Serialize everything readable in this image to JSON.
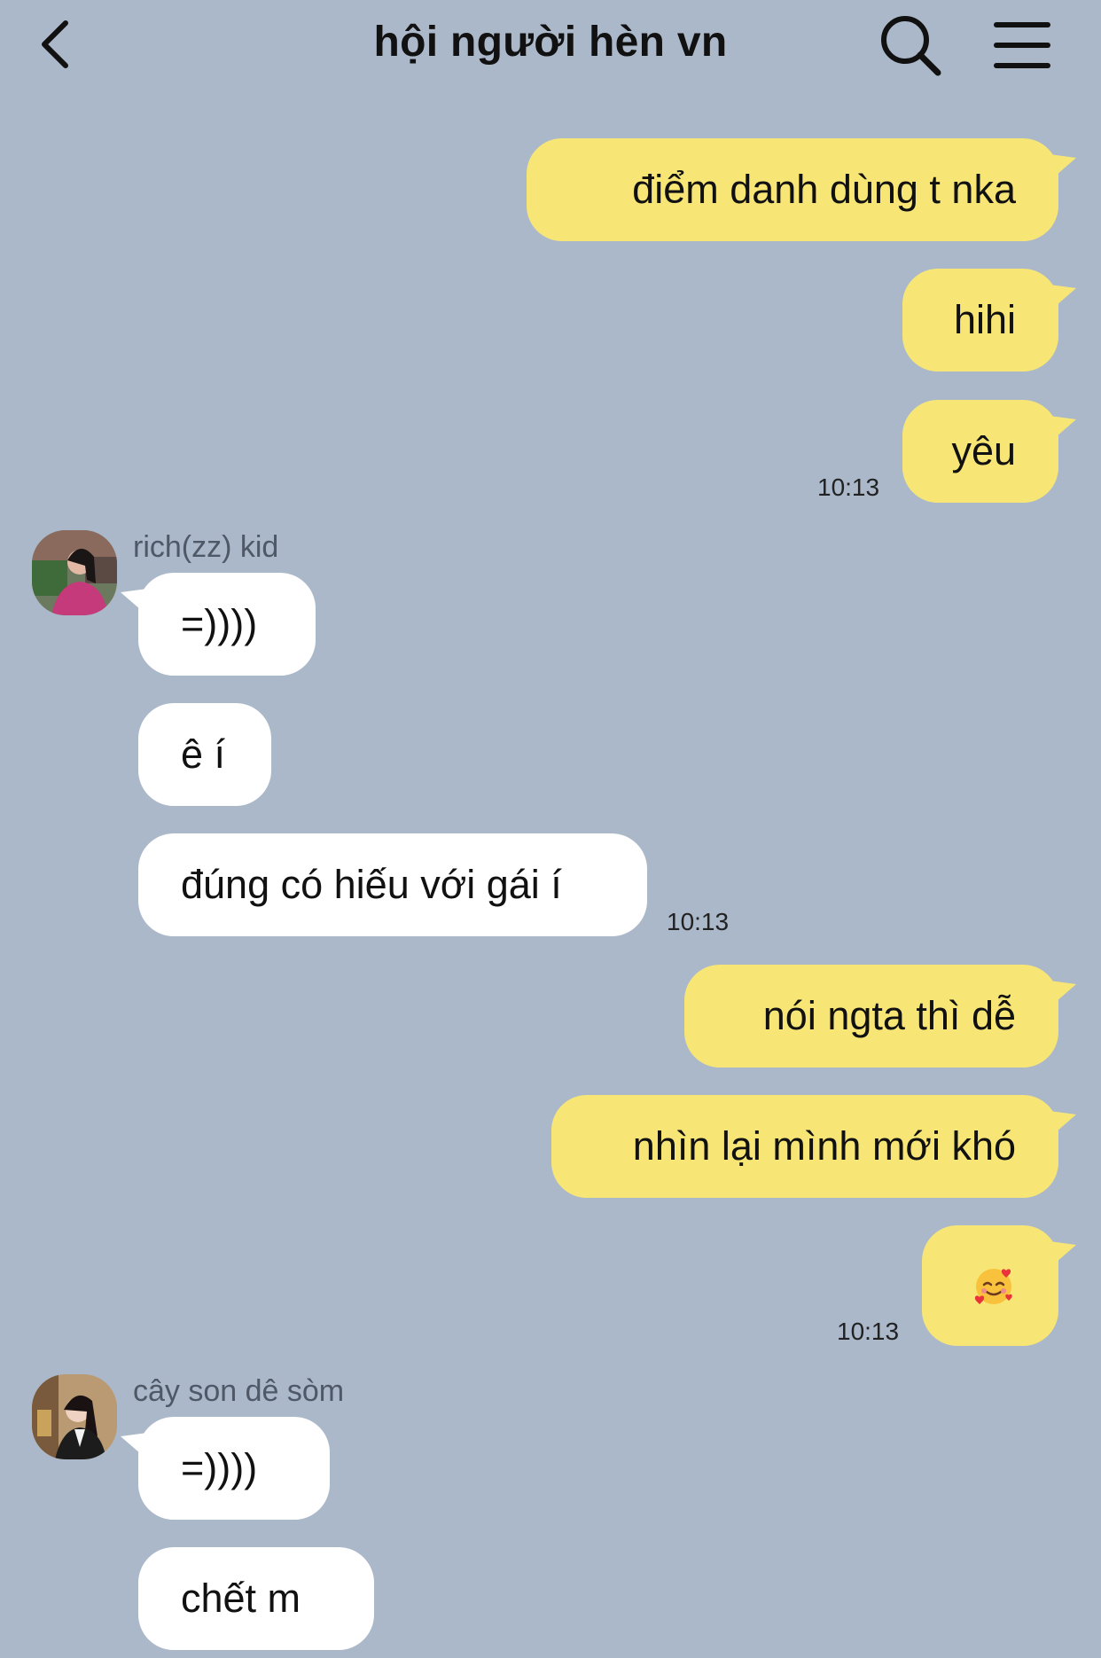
{
  "header": {
    "title": "hội người hèn vn"
  },
  "messages": {
    "out1": "điểm danh dùng t nka",
    "out2": "hihi",
    "out3": "yêu",
    "time1": "10:13",
    "sender1": "rich(zz) kid",
    "in1": "=))))",
    "in2": "ê í",
    "in3": "đúng có hiếu với gái í",
    "time2": "10:13",
    "out4": "nói ngta thì dễ",
    "out5": "nhìn lại mình mới khó",
    "out6_emoji": "smiling-face-with-hearts-emoji",
    "time3": "10:13",
    "sender2": "cây son dê sòm",
    "in4": "=))))",
    "in5": "chết m"
  },
  "colors": {
    "background": "#abb8c9",
    "outgoing_bubble": "#f7e675",
    "incoming_bubble": "#ffffff"
  }
}
